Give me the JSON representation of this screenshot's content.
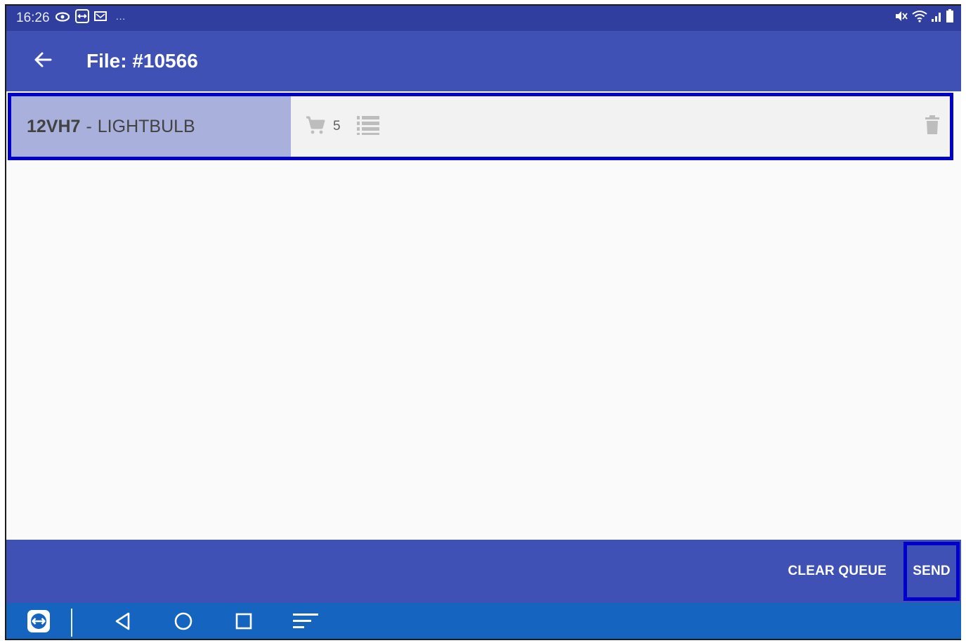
{
  "status_bar": {
    "time": "16:26",
    "left_icons": [
      "eye-icon",
      "teamviewer-icon",
      "mail-icon",
      "more-notifications-icon"
    ],
    "overflow": "···",
    "right_icons": [
      "mute-icon",
      "wifi-icon",
      "signal-icon",
      "battery-icon"
    ]
  },
  "app_bar": {
    "title": "File: #10566",
    "back_icon": "arrow-left-icon"
  },
  "queue": {
    "items": [
      {
        "code": "12VH7",
        "separator": "-",
        "name": "LIGHTBULB",
        "quantity": "5"
      }
    ],
    "icons": {
      "cart": "cart-icon",
      "details": "list-icon",
      "delete": "trash-icon"
    }
  },
  "bottom_bar": {
    "clear_label": "CLEAR QUEUE",
    "send_label": "SEND"
  },
  "nav_bar": {
    "icons": [
      "teamviewer-icon",
      "back-triangle-icon",
      "home-circle-icon",
      "recents-square-icon",
      "menu-lines-icon"
    ]
  },
  "colors": {
    "status_bar": "#303f9f",
    "primary": "#3f51b5",
    "nav_bar": "#1565c0",
    "highlight_border": "#0000cc",
    "item_label_bg": "#aab0dc"
  }
}
